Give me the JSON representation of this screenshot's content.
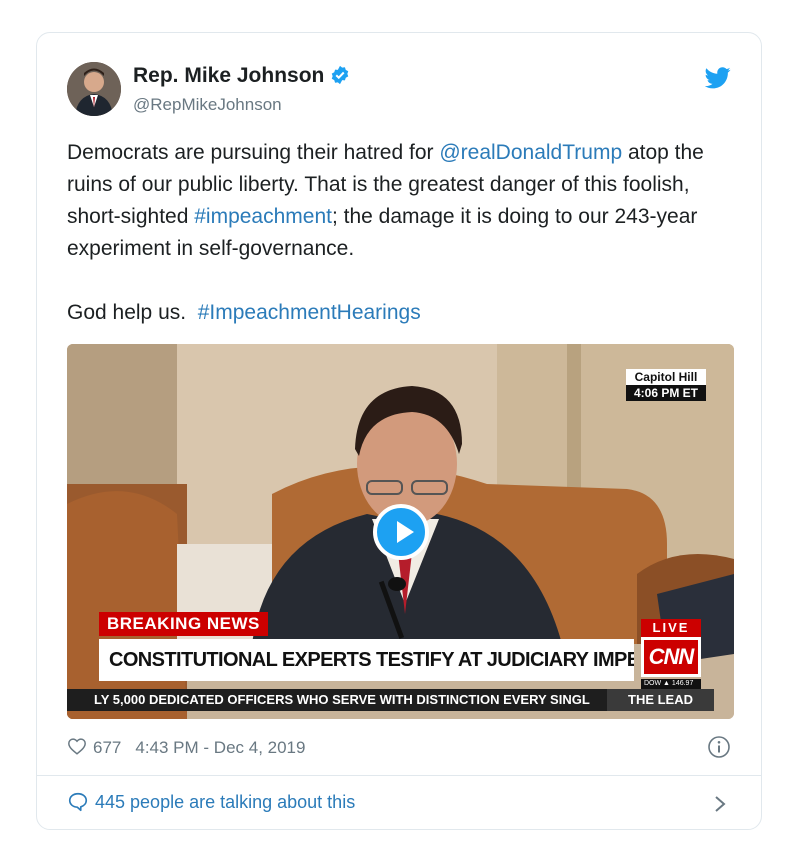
{
  "author": {
    "name": "Rep. Mike Johnson",
    "handle": "@RepMikeJohnson",
    "verified": true
  },
  "tweet": {
    "line1_pre": "Democrats are pursuing their hatred for ",
    "mention": "@realDonaldTrump",
    "line1_post": " atop the ruins of our public liberty. That is the greatest danger of this foolish, short-sighted ",
    "hashtag1": "#impeachment",
    "line1_end": "; the damage it is doing to our 243-year experiment in self-governance.",
    "line2_pre": "God help us.  ",
    "hashtag2": "#ImpeachmentHearings"
  },
  "video": {
    "location": "Capitol Hill",
    "time": "4:06 PM ET",
    "breaking": "BREAKING NEWS",
    "headline": "CONSTITUTIONAL EXPERTS TESTIFY AT JUDICIARY IMPEACHMENT HEARING",
    "live": "LIVE",
    "network": "CNN",
    "dow": "DOW ▲ 146.97",
    "ticker": "LY 5,000 DEDICATED OFFICERS WHO SERVE WITH DISTINCTION EVERY SINGL",
    "show": "THE LEAD"
  },
  "footer": {
    "likes": "677",
    "timestamp": "4:43 PM - Dec 4, 2019",
    "talking": "445 people are talking about this"
  },
  "colors": {
    "link": "#2b7bb9",
    "twitter_blue": "#1da1f2",
    "cnn_red": "#cc0000"
  }
}
